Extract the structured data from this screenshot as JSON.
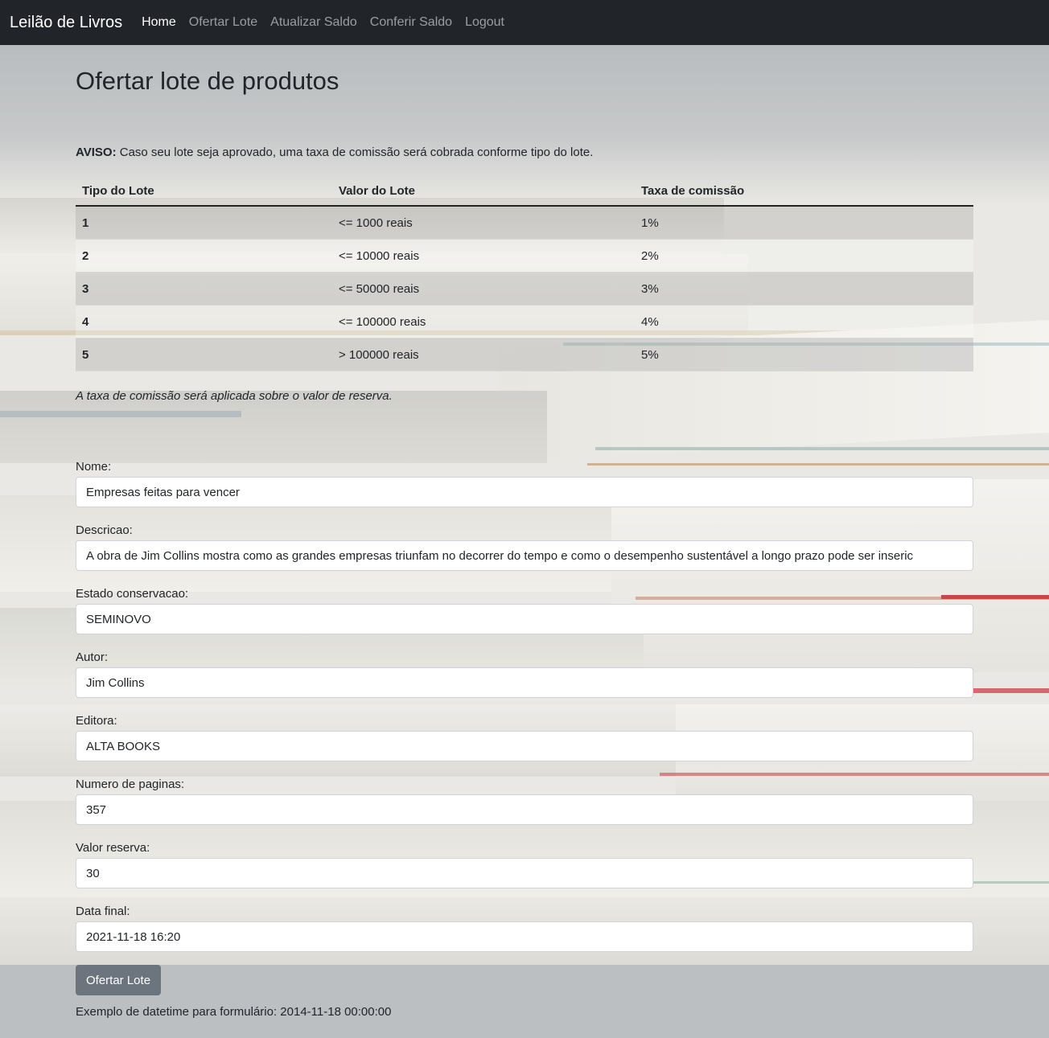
{
  "navbar": {
    "brand": "Leilão de Livros",
    "links": [
      {
        "label": "Home",
        "active": true
      },
      {
        "label": "Ofertar Lote",
        "active": false
      },
      {
        "label": "Atualizar Saldo",
        "active": false
      },
      {
        "label": "Conferir Saldo",
        "active": false
      },
      {
        "label": "Logout",
        "active": false
      }
    ]
  },
  "page": {
    "title": "Ofertar lote de produtos",
    "aviso_label": "AVISO:",
    "aviso_text": " Caso seu lote seja aprovado, uma taxa de comissão será cobrada conforme tipo do lote.",
    "nota": "A taxa de comissão será aplicada sobre o valor de reserva."
  },
  "table": {
    "headers": [
      "Tipo do Lote",
      "Valor do Lote",
      "Taxa de comissão"
    ],
    "rows": [
      [
        "1",
        "<= 1000 reais",
        "1%"
      ],
      [
        "2",
        "<= 10000 reais",
        "2%"
      ],
      [
        "3",
        "<= 50000 reais",
        "3%"
      ],
      [
        "4",
        "<= 100000 reais",
        "4%"
      ],
      [
        "5",
        "> 100000 reais",
        "5%"
      ]
    ]
  },
  "form": {
    "fields": [
      {
        "label": "Nome:",
        "value": "Empresas feitas para vencer"
      },
      {
        "label": "Descricao:",
        "value": "A obra de Jim Collins mostra como as grandes empresas triunfam no decorrer do tempo e como o desempenho sustentável a longo prazo pode ser inseric"
      },
      {
        "label": "Estado conservacao:",
        "value": "SEMINOVO"
      },
      {
        "label": "Autor:",
        "value": "Jim Collins"
      },
      {
        "label": "Editora:",
        "value": "ALTA BOOKS"
      },
      {
        "label": "Numero de paginas:",
        "value": "357"
      },
      {
        "label": "Valor reserva:",
        "value": "30"
      },
      {
        "label": "Data final:",
        "value": "2021-11-18 16:20"
      }
    ],
    "submit_label": "Ofertar Lote",
    "exemplo": "Exemplo de datetime para formulário: 2014-11-18 00:00:00"
  },
  "colors": {
    "navbar_bg": "#212529",
    "button_bg": "#6c757d",
    "text": "#212529"
  }
}
